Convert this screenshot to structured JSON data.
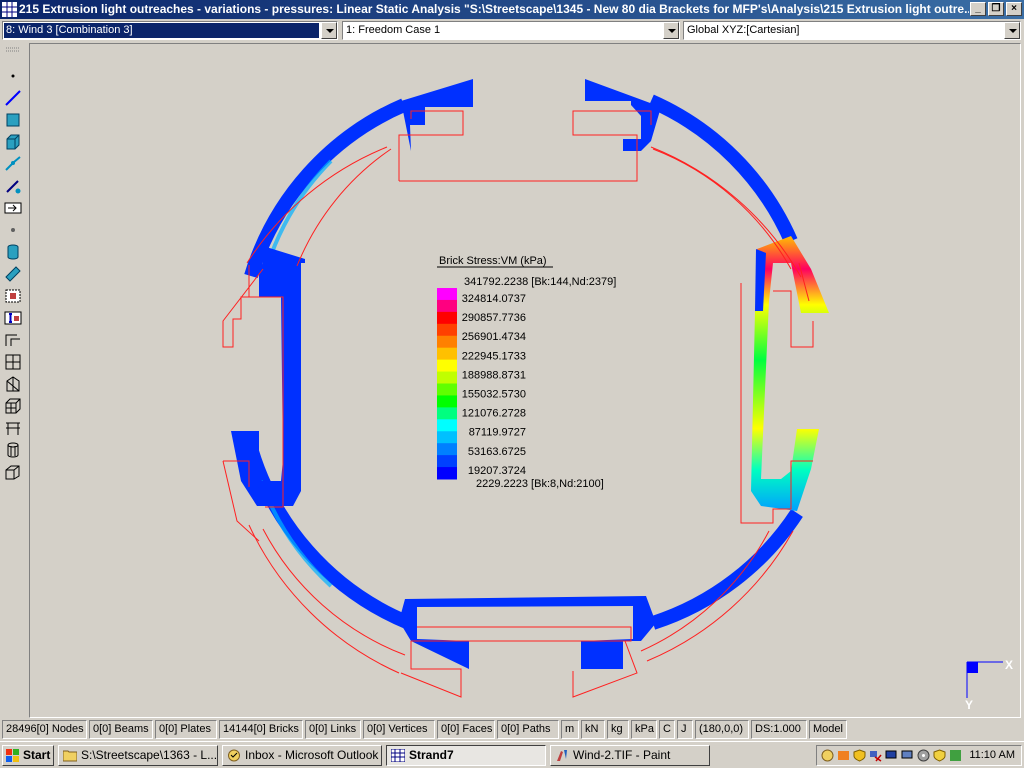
{
  "window": {
    "title": "215 Extrusion light outreaches - variations - pressures: Linear Static Analysis \"S:\\Streetscape\\1345 - New 80 dia Brackets for MFP's\\Analysis\\215 Extrusion light outre...",
    "buttons": [
      "_",
      "❐",
      "×"
    ]
  },
  "selectors": {
    "load_case": "8: Wind 3 [Combination 3]",
    "freedom_case": "1: Freedom Case 1",
    "coordinate_system": "Global XYZ:[Cartesian]"
  },
  "toolbar": {
    "icons": [
      "dot-icon",
      "line-element-icon",
      "plate-element-icon",
      "brick-element-icon",
      "link-element-icon",
      "beam-tool-icon",
      "arrow-box-icon",
      "node-icon",
      "cylinder-icon",
      "ruler-icon",
      "grid-select-icon",
      "section-icon",
      "frame-icon",
      "mesh-icon",
      "wedge-icon",
      "cube-icon",
      "table-icon",
      "cylinder-mesh-icon",
      "open-box-icon"
    ]
  },
  "legend": {
    "title": "Brick Stress:VM  (kPa)",
    "max_label": "341792.2238 [Bk:144,Nd:2379]",
    "values": [
      "324814.0737",
      "290857.7736",
      "256901.4734",
      "222945.1733",
      "188988.8731",
      "155032.5730",
      "121076.2728",
      "87119.9727",
      "53163.6725",
      "19207.3724"
    ],
    "min_label": "2229.2223 [Bk:8,Nd:2100]",
    "colors": [
      "#ff00ff",
      "#ff0080",
      "#ff0000",
      "#ff4000",
      "#ff8000",
      "#ffc000",
      "#ffff00",
      "#c0ff00",
      "#60ff00",
      "#00ff00",
      "#00ff80",
      "#00ffff",
      "#00c0ff",
      "#0080ff",
      "#0040ff",
      "#0000ff"
    ]
  },
  "axes": {
    "x_label": "X",
    "y_label": "Y"
  },
  "status": {
    "nodes": "28496[0] Nodes",
    "beams": "0[0] Beams",
    "plates": "0[0] Plates",
    "bricks": "14144[0] Bricks",
    "links": "0[0] Links",
    "vertices": "0[0] Vertices",
    "faces": "0[0] Faces",
    "paths": "0[0] Paths",
    "unit_length": "m",
    "unit_force": "kN",
    "unit_mass": "kg",
    "unit_stress": "kPa",
    "unit_temp": "C",
    "unit_energy": "J",
    "angles": "(180,0,0)",
    "ds": "DS:1.000",
    "mode": "Model"
  },
  "taskbar": {
    "start": "Start",
    "tasks": [
      "S:\\Streetscape\\1363 - L...",
      "Inbox - Microsoft Outlook",
      "Strand7",
      "Wind-2.TIF - Paint"
    ],
    "clock": "11:10 AM"
  }
}
